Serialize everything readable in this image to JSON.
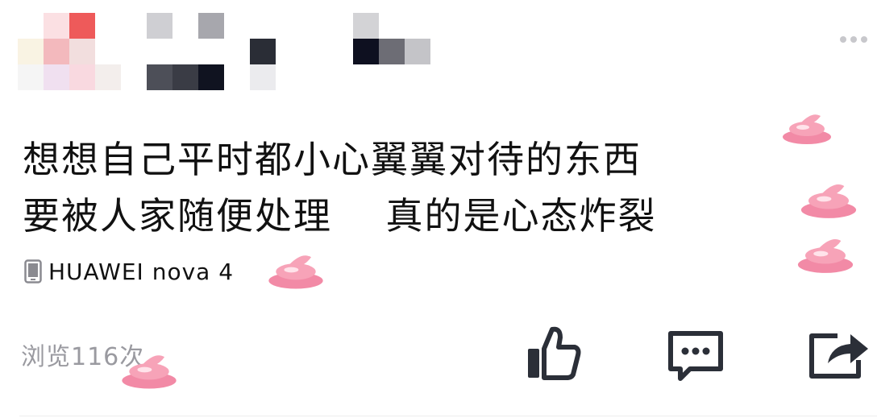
{
  "post": {
    "text_line1": "想想自己平时都小心翼翼对待的东西",
    "text_line2": "要被人家随便处理    真的是心态炸裂"
  },
  "device": {
    "icon": "phone-icon",
    "label": "HUAWEI nova 4"
  },
  "stats": {
    "views": "浏览116次"
  },
  "actions": {
    "like_icon": "thumbs-up-icon",
    "comment_icon": "comment-icon",
    "share_icon": "share-icon",
    "more_icon": "more-dots-icon"
  },
  "stickers": {
    "icon": "poop-emoji-sticker"
  },
  "colors": {
    "text": "#111111",
    "muted": "#9a9aa0",
    "icon": "#2b2f38",
    "sticker": "#f28aa6"
  }
}
